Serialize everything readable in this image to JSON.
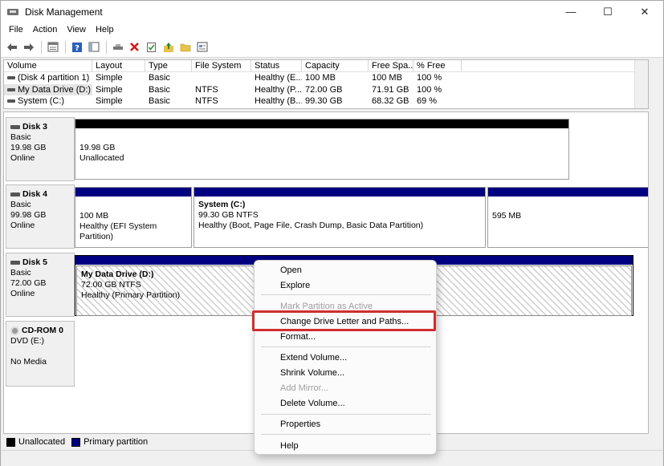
{
  "window": {
    "title": "Disk Management",
    "minimize": "—",
    "maximize": "☐",
    "close": "✕"
  },
  "menu": [
    "File",
    "Action",
    "View",
    "Help"
  ],
  "toolbar": {
    "icons": [
      "back-arrow-icon",
      "forward-arrow-icon",
      "disk-list-icon",
      "help-icon",
      "console-tree-icon",
      "connect-icon",
      "delete-icon",
      "properties-icon",
      "folder-up-icon",
      "folder-icon",
      "view-icon"
    ]
  },
  "volume_list": {
    "columns": [
      "Volume",
      "Layout",
      "Type",
      "File System",
      "Status",
      "Capacity",
      "Free Spa...",
      "% Free"
    ],
    "rows": [
      [
        "(Disk 4 partition 1)",
        "Simple",
        "Basic",
        "",
        "Healthy (E...",
        "100 MB",
        "100 MB",
        "100 %"
      ],
      [
        "My Data Drive (D:)",
        "Simple",
        "Basic",
        "NTFS",
        "Healthy (P...",
        "72.00 GB",
        "71.91 GB",
        "100 %"
      ],
      [
        "System (C:)",
        "Simple",
        "Basic",
        "NTFS",
        "Healthy (B...",
        "99.30 GB",
        "68.32 GB",
        "69 %"
      ]
    ]
  },
  "disks": {
    "disk3": {
      "name": "Disk 3",
      "type": "Basic",
      "size": "19.98 GB",
      "status": "Online",
      "p1": {
        "size": "19.98 GB",
        "status": "Unallocated"
      }
    },
    "disk4": {
      "name": "Disk 4",
      "type": "Basic",
      "size": "99.98 GB",
      "status": "Online",
      "p1": {
        "size": "100 MB",
        "status": "Healthy (EFI System Partition)"
      },
      "p2": {
        "name": "System  (C:)",
        "size": "99.30 GB NTFS",
        "status": "Healthy (Boot, Page File, Crash Dump, Basic Data Partition)"
      },
      "p3": {
        "size": "595 MB"
      }
    },
    "disk5": {
      "name": "Disk 5",
      "type": "Basic",
      "size": "72.00 GB",
      "status": "Online",
      "p1": {
        "name": "My Data Drive  (D:)",
        "size": "72.00 GB NTFS",
        "status": "Healthy (Primary Partition)"
      }
    },
    "cdrom0": {
      "name": "CD-ROM 0",
      "drive": "DVD (E:)",
      "media": "No Media"
    }
  },
  "legend": {
    "unallocated": "Unallocated",
    "primary": "Primary partition",
    "unallocated_color": "#000000",
    "primary_color": "#000080"
  },
  "context_menu": {
    "open": "Open",
    "explore": "Explore",
    "mark_active": "Mark Partition as Active",
    "change_letter": "Change Drive Letter and Paths...",
    "format": "Format...",
    "extend": "Extend Volume...",
    "shrink": "Shrink Volume...",
    "add_mirror": "Add Mirror...",
    "delete": "Delete Volume...",
    "properties": "Properties",
    "help": "Help"
  },
  "highlight_color": "#cf2e2e"
}
